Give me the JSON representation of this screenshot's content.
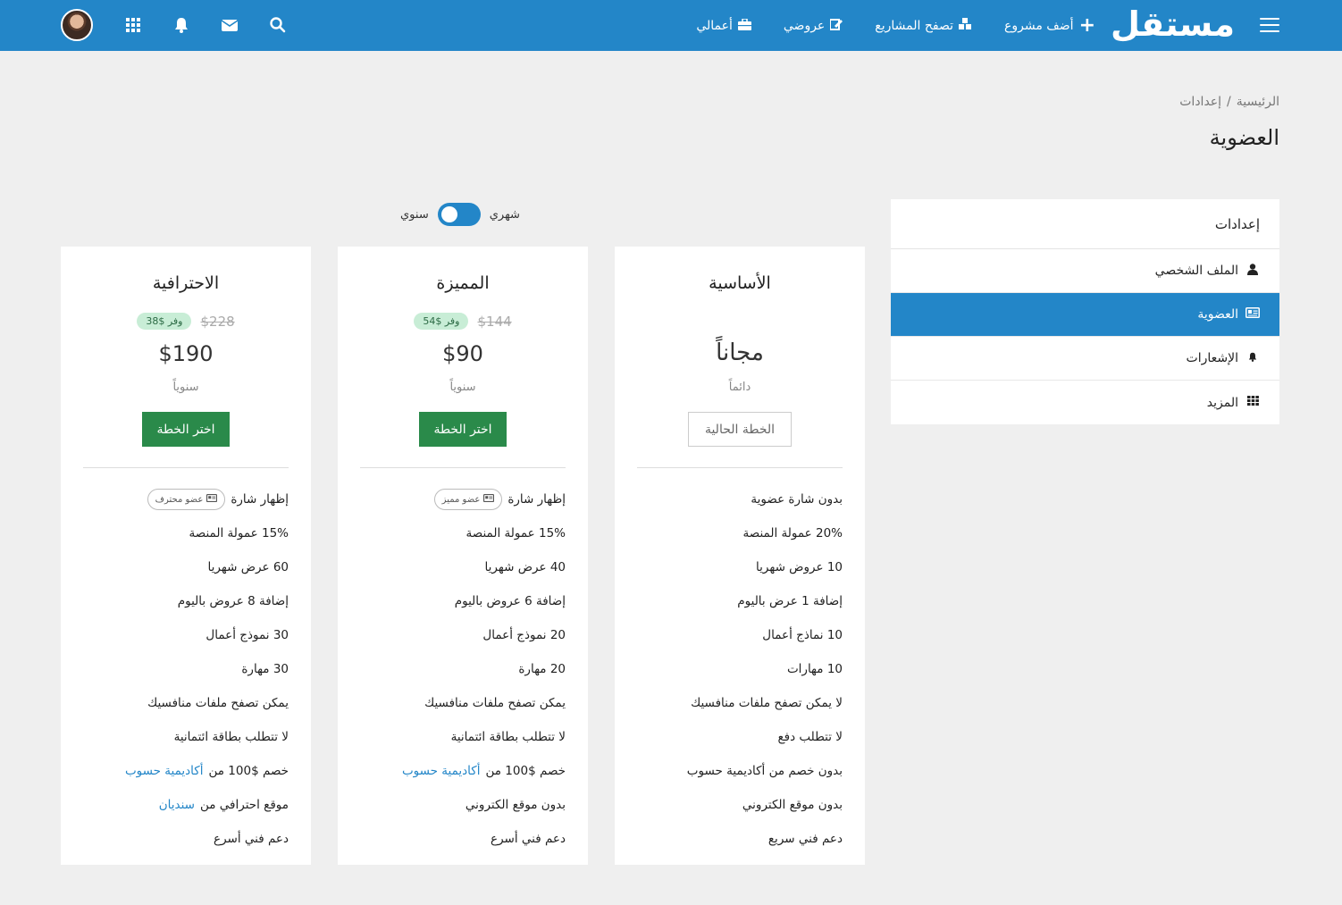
{
  "navbar": {
    "logo_text": "مستقل",
    "links": [
      {
        "label": "أضف مشروع",
        "icon": "plus-icon"
      },
      {
        "label": "تصفح المشاريع",
        "icon": "cubes-icon"
      },
      {
        "label": "عروضي",
        "icon": "edit-icon"
      },
      {
        "label": "أعمالي",
        "icon": "briefcase-icon"
      }
    ],
    "icons": [
      "avatar",
      "apps-grid-icon",
      "bell-icon",
      "envelope-icon",
      "search-icon"
    ],
    "color": "#2386c8"
  },
  "breadcrumb": {
    "home": "الرئيسية",
    "separator": "/",
    "current": "إعدادات"
  },
  "page_title": "العضوية",
  "sidebar": {
    "header": "إعدادات",
    "items": [
      {
        "label": "الملف الشخصي",
        "icon": "user-icon",
        "active": false
      },
      {
        "label": "العضوية",
        "icon": "id-card-icon",
        "active": true
      },
      {
        "label": "الإشعارات",
        "icon": "bell-icon",
        "active": false
      },
      {
        "label": "المزيد",
        "icon": "grid-icon",
        "active": false
      }
    ]
  },
  "billing_toggle": {
    "monthly_label": "شهري",
    "yearly_label": "سنوي",
    "selected": "شهري"
  },
  "plans": [
    {
      "name": "الأساسية",
      "price": "مجاناً",
      "period": "دائماً",
      "button_label": "الخطة الحالية",
      "features": [
        "بدون شارة عضوية",
        "20% عمولة المنصة",
        "10 عروض شهريا",
        "إضافة 1 عرض باليوم",
        "10 نماذج أعمال",
        "10 مهارات",
        "لا يمكن تصفح ملفات منافسيك",
        "لا تتطلب دفع",
        "بدون خصم من أكاديمية حسوب",
        "بدون موقع الكتروني",
        "دعم فني سريع"
      ]
    },
    {
      "name": "المميزة",
      "old_price": "$144",
      "save_badge": "وفر $54",
      "price": "$90",
      "period": "سنوياً",
      "button_label": "اختر الخطة",
      "badge_feature_label": "إظهار شارة",
      "badge_label": "عضو مميز",
      "features": [
        "15% عمولة المنصة",
        "40 عرض شهريا",
        "إضافة 6 عروض باليوم",
        "20 نموذج أعمال",
        "20 مهارة",
        "يمكن تصفح ملفات منافسيك",
        "لا تتطلب بطاقة ائتمانية"
      ],
      "discount_prefix": "خصم $100 من",
      "discount_link": "أكاديمية حسوب",
      "website_text": "بدون موقع الكتروني",
      "support_text": "دعم فني أسرع"
    },
    {
      "name": "الاحترافية",
      "old_price": "$228",
      "save_badge": "وفر $38",
      "price": "$190",
      "period": "سنوياً",
      "button_label": "اختر الخطة",
      "badge_feature_label": "إظهار شارة",
      "badge_label": "عضو محترف",
      "features": [
        "15% عمولة المنصة",
        "60 عرض شهريا",
        "إضافة 8 عروض باليوم",
        "30 نموذج أعمال",
        "30 مهارة",
        "يمكن تصفح ملفات منافسيك",
        "لا تتطلب بطاقة ائتمانية"
      ],
      "discount_prefix": "خصم $100 من",
      "discount_link": "أكاديمية حسوب",
      "website_prefix": "موقع احترافي من",
      "website_link": "سنديان",
      "support_text": "دعم فني أسرع"
    }
  ],
  "colors": {
    "primary": "#2386c8",
    "action_green": "#2a8a4a",
    "save_badge_bg": "#c8edd6"
  }
}
